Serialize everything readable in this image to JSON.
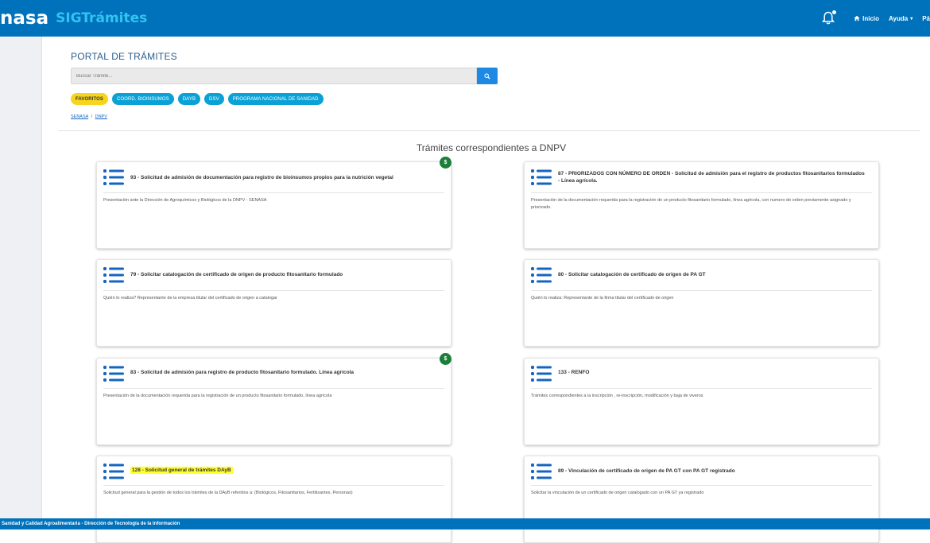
{
  "header": {
    "brand_name": "nasa",
    "app_name": "SIGTrámites",
    "nav": {
      "inicio": "Inicio",
      "ayuda": "Ayuda",
      "pa": "Pá"
    },
    "bg_color": "#0072bb"
  },
  "portal": {
    "title": "PORTAL DE TRÁMITES",
    "search_placeholder": "Buscar Trámite..."
  },
  "chips": [
    {
      "label": "FAVORITOS"
    },
    {
      "label": "COORD. BIOINSUMOS"
    },
    {
      "label": "DAYB"
    },
    {
      "label": "DSV"
    },
    {
      "label": "PROGRAMA NACIONAL DE SANIDAD"
    }
  ],
  "breadcrumb": {
    "root": "SENASA",
    "separator": "/",
    "current": "DNPV"
  },
  "section_title": "Trámites correspondientes a DNPV",
  "cards": [
    {
      "title": "93 - Solicitud de admisión de documentación para registro de bioinsumos propios para la nutrición vegetal",
      "description": "Presentación ante la Dirección de Agroquímicos y Biológicos de la DNPV - SENASA",
      "paid_badge": "$"
    },
    {
      "title": "87 - PRIORIZADOS CON NÚMERO DE ORDEN - Solicitud de admisión para el registro de productos fitosanitarios formulados - Línea agrícola.",
      "description": "Presentación de la documentación requerida para la registración de un producto fitosanitario formulado, línea agrícola, con numero de orden previamente asignado y priorizado."
    },
    {
      "title": "79 - Solicitar catalogación de certificado de origen de producto fitosanitario formulado",
      "description": "Quién lo realiza? Representante de la empresa titular del certificado de origen a catalogar"
    },
    {
      "title": "80 - Solicitar catalogación de certificado de origen de PA GT",
      "description": "Quién lo realiza: Representante de la firma titular del certificado de origen"
    },
    {
      "title": "83 - Solicitud de admisión para registro de producto fitosanitario formulado. Línea agrícola",
      "description": "Presentación de la documentación requerida para la registración de un producto fitosanitario formulado, línea agrícola",
      "paid_badge": "$"
    },
    {
      "title": "133 - RENFO",
      "description": "Trámites correspondientes a la inscripción , re-inscripción, modificación y baja de viveros"
    },
    {
      "title": "128 - Solicitud general de trámites DAyB",
      "description": "Solicitud general para la gestión de todos los trámites de la DAyB referidos a: (Biológicos, Fitosanitarios, Fertilizantes, Personas)",
      "highlighted": true
    },
    {
      "title": "89 - Vinculación de certificado de origen de PA GT con PA GT registrado",
      "description": "Solicitar la vinculación de un certificado de origen catalogado con un PA GT ya registrado"
    }
  ],
  "footer": {
    "text": "Sanidad y Calidad Agroalimentaria - Dirección de Tecnología de la Información"
  },
  "colors": {
    "primary": "#0072bb",
    "chip": "#0aa2d6",
    "favorites": "#f7d51d",
    "paid": "#1b7f3a",
    "highlight": "#ffff2e"
  },
  "icons": {
    "notifications": "bell-icon",
    "home": "home-icon",
    "search": "search-icon",
    "tramite": "list-icon"
  }
}
